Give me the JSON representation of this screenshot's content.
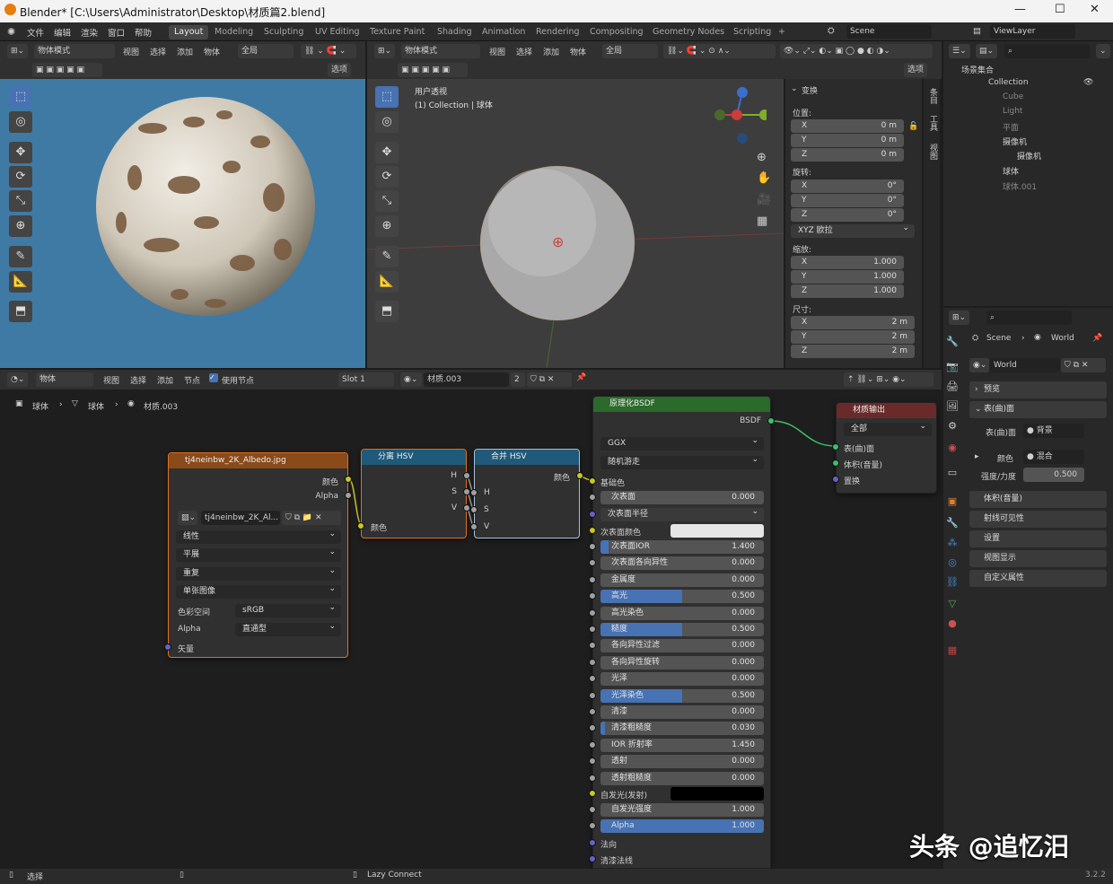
{
  "window": {
    "title": "Blender* [C:\\Users\\Administrator\\Desktop\\材质篇2.blend]",
    "min": "—",
    "max": "☐",
    "close": "✕"
  },
  "menu": [
    "文件",
    "编辑",
    "渲染",
    "窗口",
    "帮助"
  ],
  "workspaces": [
    "Layout",
    "Modeling",
    "Sculpting",
    "UV Editing",
    "Texture Paint",
    "Shading",
    "Animation",
    "Rendering",
    "Compositing",
    "Geometry Nodes",
    "Scripting",
    "+"
  ],
  "scene": "Scene",
  "view_layer": "ViewLayer",
  "vp_left": {
    "mode": "物体模式",
    "menus": [
      "视图",
      "选择",
      "添加",
      "物体"
    ],
    "orient": "全局",
    "options": "选项"
  },
  "vp_right": {
    "mode": "物体模式",
    "menus": [
      "视图",
      "选择",
      "添加",
      "物体"
    ],
    "orient": "全局",
    "options": "选项",
    "view_name": "用户透视",
    "collection_info": "(1) Collection | 球体"
  },
  "transform": {
    "header": "变换",
    "location_label": "位置:",
    "location": [
      {
        "axis": "X",
        "val": "0 m"
      },
      {
        "axis": "Y",
        "val": "0 m"
      },
      {
        "axis": "Z",
        "val": "0 m"
      }
    ],
    "rotation_label": "旋转:",
    "rotation": [
      {
        "axis": "X",
        "val": "0°"
      },
      {
        "axis": "Y",
        "val": "0°"
      },
      {
        "axis": "Z",
        "val": "0°"
      }
    ],
    "rot_mode": "XYZ 欧拉",
    "scale_label": "缩放:",
    "scale": [
      {
        "axis": "X",
        "val": "1.000"
      },
      {
        "axis": "Y",
        "val": "1.000"
      },
      {
        "axis": "Z",
        "val": "1.000"
      }
    ],
    "dims_label": "尺寸:",
    "dims": [
      {
        "axis": "X",
        "val": "2 m"
      },
      {
        "axis": "Y",
        "val": "2 m"
      },
      {
        "axis": "Z",
        "val": "2 m"
      }
    ]
  },
  "side_tabs": [
    "条目",
    "工具",
    "视图"
  ],
  "outliner": {
    "root": "场景集合",
    "collection": "Collection",
    "items": [
      {
        "name": "Cube",
        "dim": true
      },
      {
        "name": "Light",
        "dim": true
      },
      {
        "name": "平面",
        "dim": true
      },
      {
        "name": "摄像机",
        "dim": false
      },
      {
        "name": "摄像机",
        "dim": false
      },
      {
        "name": "球体",
        "dim": false
      },
      {
        "name": "球体.001",
        "dim": true
      }
    ]
  },
  "props": {
    "breadcrumb_scene": "Scene",
    "breadcrumb_world": "World",
    "world_name": "World",
    "panels": [
      "预览",
      "表(曲)面"
    ],
    "surface_label": "表(曲)面",
    "surface_value": "背景",
    "color_label": "颜色",
    "color_value": "混合",
    "strength_label": "强度/力度",
    "strength_value": "0.500",
    "more_panels": [
      "体积(音量)",
      "射线可见性",
      "设置",
      "视图显示",
      "自定义属性"
    ]
  },
  "node_editor": {
    "type": "物体",
    "menus": [
      "视图",
      "选择",
      "添加",
      "节点"
    ],
    "use_nodes": "使用节点",
    "slot": "Slot 1",
    "material": "材质.003",
    "users": "2",
    "breadcrumb": [
      "球体",
      "球体",
      "材质.003"
    ]
  },
  "image_node": {
    "title": "tj4neinbw_2K_Albedo.jpg",
    "out_color": "颜色",
    "out_alpha": "Alpha",
    "image": "tj4neinbw_2K_Al...",
    "interp": "线性",
    "proj": "平展",
    "ext": "重复",
    "src": "单张图像",
    "cs_label": "色彩空间",
    "cs_value": "sRGB",
    "alpha_label": "Alpha",
    "alpha_value": "直通型",
    "vector": "矢量"
  },
  "sep_node": {
    "title": "分离 HSV",
    "outs": [
      "H",
      "S",
      "V"
    ],
    "in": "颜色"
  },
  "comb_node": {
    "title": "合并 HSV",
    "out": "颜色",
    "ins": [
      "H",
      "S",
      "V"
    ]
  },
  "bsdf": {
    "title": "原理化BSDF",
    "out": "BSDF",
    "dist": "GGX",
    "sss_method": "随机游走",
    "base_color": "基础色",
    "sss_color": "次表面颜色",
    "emission": "自发光(发射)",
    "normal": "法向",
    "coat_normal": "清漆法线",
    "subsurface_radius": "次表面半径",
    "sliders": [
      {
        "label": "次表面",
        "val": "0.000",
        "fill": 0
      },
      {
        "label": "次表面IOR",
        "val": "1.400",
        "fill": 0.05
      },
      {
        "label": "次表面各向异性",
        "val": "0.000",
        "fill": 0
      },
      {
        "label": "金属度",
        "val": "0.000",
        "fill": 0
      },
      {
        "label": "高光",
        "val": "0.500",
        "fill": 0.5
      },
      {
        "label": "高光染色",
        "val": "0.000",
        "fill": 0
      },
      {
        "label": "糙度",
        "val": "0.500",
        "fill": 0.5
      },
      {
        "label": "各向异性过滤",
        "val": "0.000",
        "fill": 0
      },
      {
        "label": "各向异性旋转",
        "val": "0.000",
        "fill": 0
      },
      {
        "label": "光泽",
        "val": "0.000",
        "fill": 0
      },
      {
        "label": "光泽染色",
        "val": "0.500",
        "fill": 0.5
      },
      {
        "label": "清漆",
        "val": "0.000",
        "fill": 0
      },
      {
        "label": "清漆粗糙度",
        "val": "0.030",
        "fill": 0.03
      },
      {
        "label": "IOR 折射率",
        "val": "1.450",
        "fill": 0
      },
      {
        "label": "透射",
        "val": "0.000",
        "fill": 0
      },
      {
        "label": "透射粗糙度",
        "val": "0.000",
        "fill": 0
      }
    ],
    "emission_strength": {
      "label": "自发光强度",
      "val": "1.000"
    },
    "alpha": {
      "label": "Alpha",
      "val": "1.000"
    }
  },
  "output_node": {
    "title": "材质输出",
    "target": "全部",
    "ins": [
      "表(曲)面",
      "体积(音量)",
      "置换"
    ]
  },
  "status": {
    "select": "选择",
    "lazy": "Lazy Connect",
    "version": "3.2.2"
  },
  "watermark": "头条 @追忆汨",
  "colors": {
    "bsdf_header": "#2a6a2a",
    "image_header": "#8a4a1a",
    "hsv_header": "#1f5a7a",
    "output_header": "#6a2a2a",
    "accent": "#4772b3"
  }
}
